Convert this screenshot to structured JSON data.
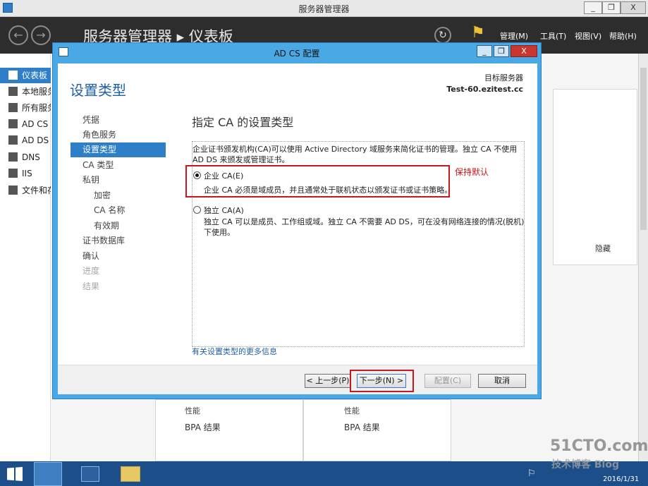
{
  "window": {
    "title": "服务器管理器",
    "min": "_",
    "restore": "❐",
    "close": "X"
  },
  "header": {
    "back": "←",
    "forward": "→",
    "crumb": "服务器管理器 ▸ 仪表板",
    "refresh": "↻",
    "flag": "⚑",
    "menus": [
      "管理(M)",
      "工具(T)",
      "视图(V)",
      "帮助(H)"
    ]
  },
  "sidebar": {
    "items": [
      {
        "label": "仪表板",
        "selected": true
      },
      {
        "label": "本地服务器"
      },
      {
        "label": "所有服务器"
      },
      {
        "label": "AD CS"
      },
      {
        "label": "AD DS"
      },
      {
        "label": "DNS"
      },
      {
        "label": "IIS"
      },
      {
        "label": "文件和存储服务"
      }
    ]
  },
  "dashboard": {
    "hide": "隐藏",
    "tile1": {
      "perf": "性能",
      "bpa": "BPA 结果"
    },
    "tile2": {
      "perf": "性能",
      "bpa": "BPA 结果"
    }
  },
  "dialog": {
    "title": "AD CS 配置",
    "page_title": "设置类型",
    "target_label": "目标服务器",
    "target_server": "Test-60.ezitest.cc",
    "steps": [
      {
        "label": "凭据"
      },
      {
        "label": "角色服务"
      },
      {
        "label": "设置类型",
        "selected": true
      },
      {
        "label": "CA 类型"
      },
      {
        "label": "私钥"
      },
      {
        "label": "加密",
        "sub": true
      },
      {
        "label": "CA 名称",
        "sub": true
      },
      {
        "label": "有效期",
        "sub": true
      },
      {
        "label": "证书数据库"
      },
      {
        "label": "确认"
      },
      {
        "label": "进度",
        "disabled": true
      },
      {
        "label": "结果",
        "disabled": true
      }
    ],
    "heading": "指定 CA 的设置类型",
    "description": "企业证书颁发机构(CA)可以使用 Active Directory 域服务来简化证书的管理。独立 CA 不使用 AD DS 来颁发或管理证书。",
    "options": [
      {
        "label": "企业 CA(E)",
        "desc": "企业 CA 必须是域成员，并且通常处于联机状态以颁发证书或证书策略。",
        "selected": true
      },
      {
        "label": "独立 CA(A)",
        "desc": "独立 CA 可以是成员、工作组或域。独立 CA 不需要 AD DS，可在没有网络连接的情况(脱机)下使用。",
        "selected": false
      }
    ],
    "annotation": "保持默认",
    "more_info_link": "有关设置类型的更多信息",
    "buttons": {
      "prev": "< 上一步(P)",
      "next": "下一步(N) >",
      "configure": "配置(C)",
      "cancel": "取消"
    }
  },
  "taskbar": {
    "date": "2016/1/31"
  },
  "watermark": {
    "site": "51CTO.com",
    "sub": "技术博客 Blog"
  },
  "colors": {
    "accent": "#2e7fc8",
    "dialog_frame": "#4aa9e5",
    "annotation": "#c8171e",
    "header": "#2d2d2d",
    "taskbar": "#1c4f8a"
  }
}
